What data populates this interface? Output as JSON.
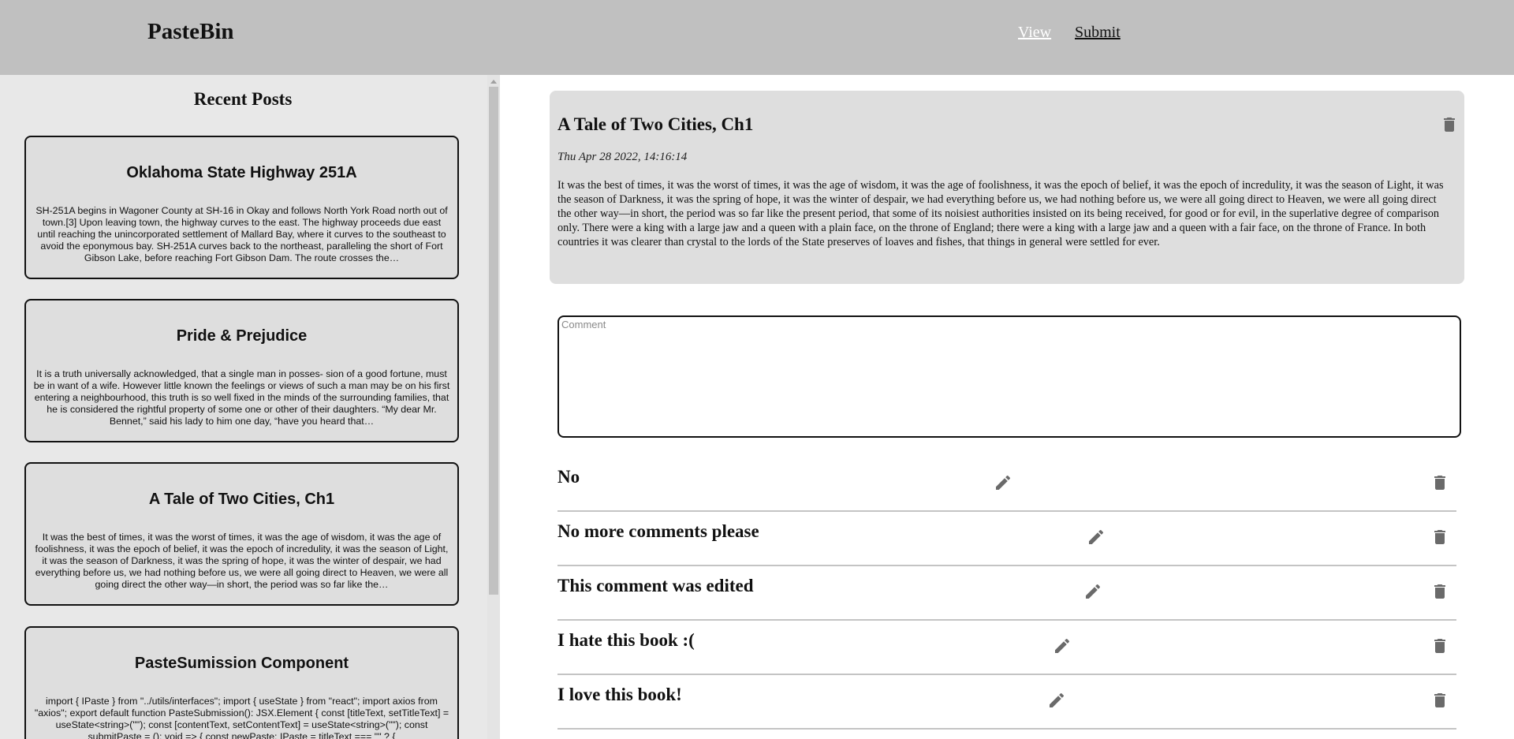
{
  "header": {
    "brand": "PasteBin",
    "nav": [
      {
        "label": "View"
      },
      {
        "label": "Submit"
      }
    ]
  },
  "sidebar": {
    "title": "Recent Posts",
    "posts": [
      {
        "title": "Oklahoma State Highway 251A",
        "excerpt": "SH-251A begins in Wagoner County at SH-16 in Okay and follows North York Road north out of town.[3] Upon leaving town, the highway curves to the east. The highway proceeds due east until reaching the unincorporated settlement of Mallard Bay, where it curves to the southeast to avoid the eponymous bay. SH-251A curves back to the northeast, paralleling the short of Fort Gibson Lake, before reaching Fort Gibson Dam. The route crosses the…"
      },
      {
        "title": "Pride & Prejudice",
        "excerpt": "It is a truth universally acknowledged, that a single man in posses- sion of a good fortune, must be in want of a wife. However little known the feelings or views of such a man may be on his first entering a neighbourhood, this truth is so well fixed in the minds of the surrounding families, that he is considered the rightful property of some one or other of their daughters. “My dear Mr. Bennet,” said his lady to him one day, “have you heard that…"
      },
      {
        "title": "A Tale of Two Cities, Ch1",
        "excerpt": "It was the best of times, it was the worst of times, it was the age of wisdom, it was the age of foolishness, it was the epoch of belief, it was the epoch of incredulity, it was the season of Light, it was the season of Darkness, it was the spring of hope, it was the winter of despair, we had everything before us, we had nothing before us, we were all going direct to Heaven, we were all going direct the other way—in short, the period was so far like the…"
      },
      {
        "title": "PasteSumission Component",
        "excerpt": "import { IPaste } from \"../utils/interfaces\"; import { useState } from \"react\"; import axios from \"axios\"; export default function PasteSubmission(): JSX.Element { const [titleText, setTitleText] = useState<string>(\"\"); const [contentText, setContentText] = useState<string>(\"\"); const submitPaste = (): void => { const newPaste: IPaste = titleText === \"\" ? {"
      }
    ]
  },
  "post": {
    "title": "A Tale of Two Cities, Ch1",
    "date": "Thu Apr 28 2022, 14:16:14",
    "body": "It was the best of times, it was the worst of times, it was the age of wisdom, it was the age of foolishness, it was the epoch of belief, it was the epoch of incredulity, it was the season of Light, it was the season of Darkness, it was the spring of hope, it was the winter of despair, we had everything before us, we had nothing before us, we were all going direct to Heaven, we were all going direct the other way—in short, the period was so far like the present period, that some of its noisiest authorities insisted on its being received, for good or for evil, in the superlative degree of comparison only. There were a king with a large jaw and a queen with a plain face, on the throne of England; there were a king with a large jaw and a queen with a fair face, on the throne of France. In both countries it was clearer than crystal to the lords of the State preserves of loaves and fishes, that things in general were settled for ever."
  },
  "comment_input": {
    "placeholder": "Comment",
    "value": ""
  },
  "comments": [
    {
      "text": "No"
    },
    {
      "text": "No more comments please"
    },
    {
      "text": "This comment was edited"
    },
    {
      "text": "I hate this book :("
    },
    {
      "text": "I love this book!"
    }
  ],
  "icons": {
    "delete": "trash-icon",
    "edit": "pencil-icon"
  },
  "colors": {
    "header_bg": "#c0c0c0",
    "sidebar_bg": "#e8e8e8",
    "card_bg": "#dedede",
    "active_nav": "#ffffff"
  }
}
